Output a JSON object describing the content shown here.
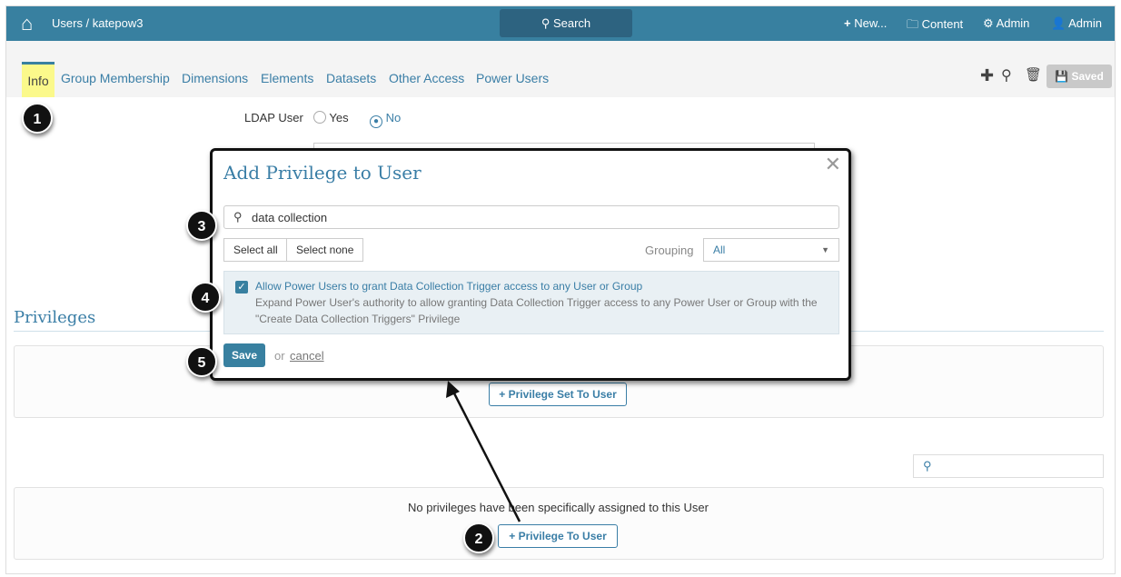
{
  "header": {
    "breadcrumb": "Users / katepow3",
    "search": "Search",
    "new": "New...",
    "content": "Content",
    "admin_settings": "Admin",
    "user": "Admin"
  },
  "tabs": [
    "Info",
    "Group Membership",
    "Dimensions",
    "Elements",
    "Datasets",
    "Other Access",
    "Power Users"
  ],
  "toolbar": {
    "saved": "Saved"
  },
  "form": {
    "ldap_label": "LDAP User",
    "yes": "Yes",
    "no": "No",
    "ldap_value": "No"
  },
  "privileges": {
    "title": "Privileges",
    "set_button": "Privilege Set To User",
    "empty": "No privileges have been specifically assigned to this User",
    "add_button": "Privilege To User"
  },
  "modal": {
    "title": "Add Privilege to User",
    "search_value": "data collection",
    "select_all": "Select all",
    "select_none": "Select none",
    "grouping_label": "Grouping",
    "grouping_value": "All",
    "item": {
      "title": "Allow Power Users to grant Data Collection Trigger access to any User or Group",
      "desc1": "Expand Power User's authority to allow granting Data Collection Trigger access to any Power User or Group with the",
      "desc2": "\"Create Data Collection Triggers\" Privilege",
      "checked": true
    },
    "save": "Save",
    "or": "or",
    "cancel": "cancel"
  },
  "annotations": [
    "1",
    "2",
    "3",
    "4",
    "5"
  ],
  "colors": {
    "primary": "#3880a0",
    "tab_highlight": "#fbf98b"
  }
}
